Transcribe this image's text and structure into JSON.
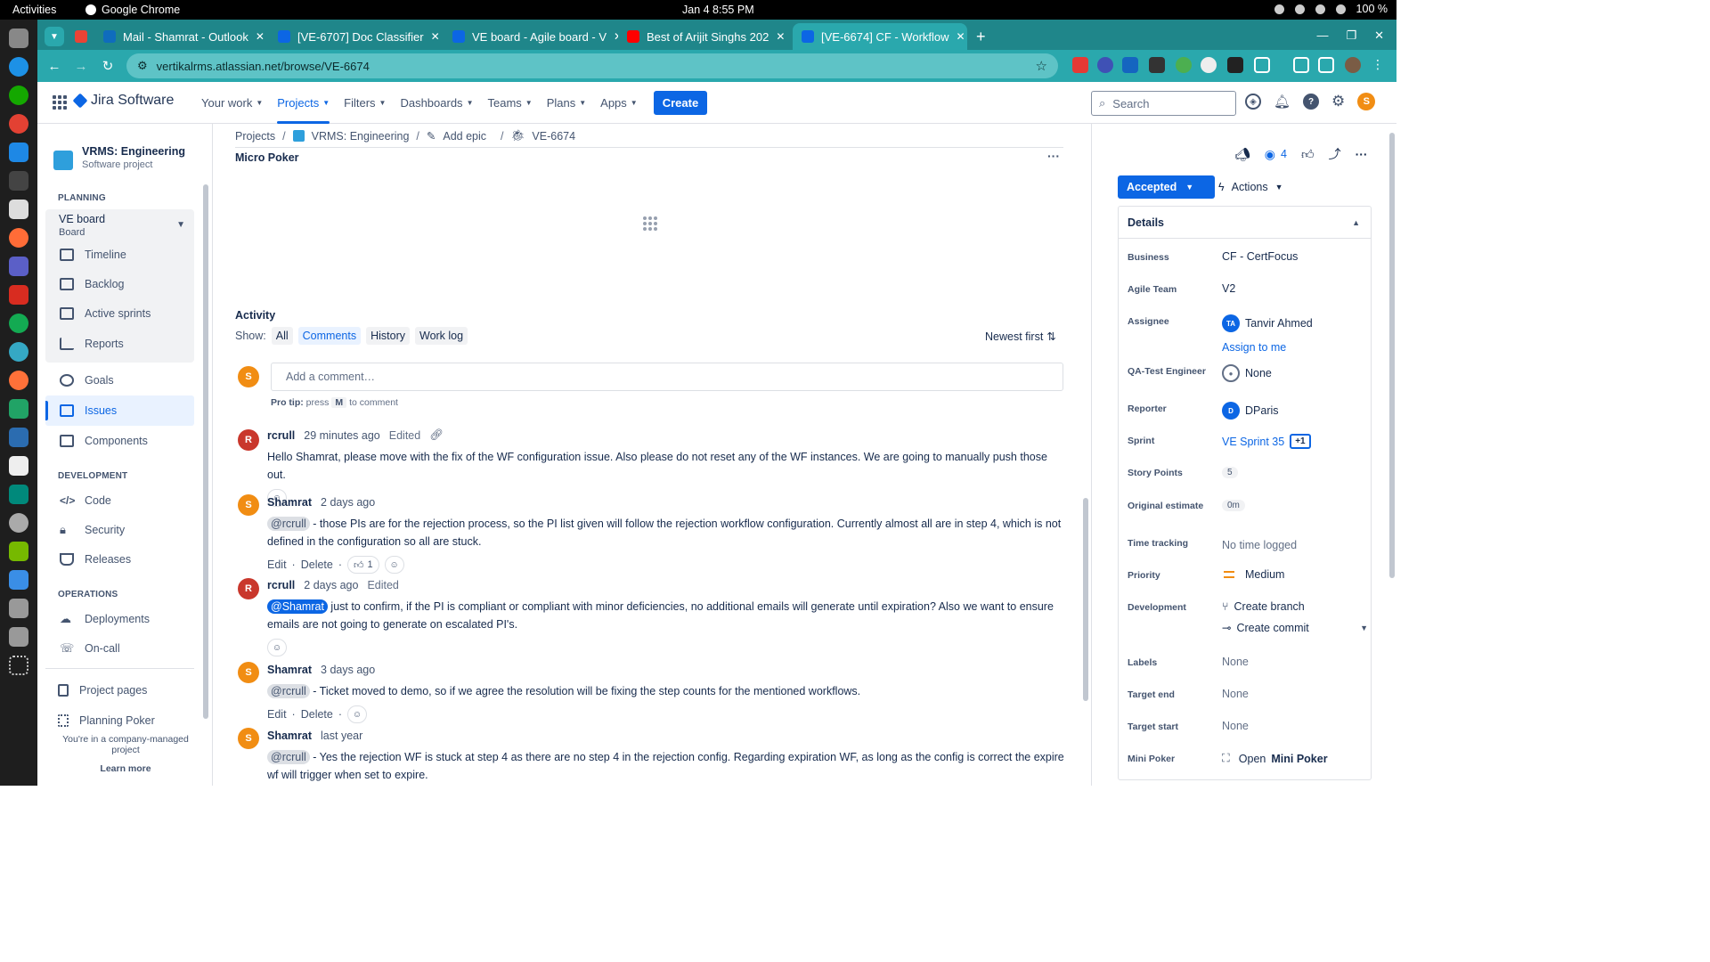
{
  "os": {
    "activities": "Activities",
    "app_name": "Google Chrome",
    "clock": "Jan 4  8:55 PM",
    "battery": "100 %"
  },
  "browser": {
    "tabs": [
      {
        "title": "Mail - Shamrat - Outlook",
        "icon": "outlook-icon",
        "color": "#0f6cbd"
      },
      {
        "title": "[VE-6707] Doc Classifier",
        "icon": "jira-icon",
        "color": "#0c66e4"
      },
      {
        "title": "VE board - Agile board - V",
        "icon": "jira-icon",
        "color": "#0c66e4"
      },
      {
        "title": "Best of Arijit Singhs 202",
        "icon": "youtube-icon",
        "color": "#ff0000"
      },
      {
        "title": "[VE-6674] CF - Workflow",
        "icon": "jira-icon",
        "color": "#0c66e4",
        "active": true
      }
    ],
    "url": "vertikalrms.atlassian.net/browse/VE-6674"
  },
  "jira": {
    "product": "Jira Software",
    "nav": {
      "your_work": "Your work",
      "projects": "Projects",
      "filters": "Filters",
      "dashboards": "Dashboards",
      "teams": "Teams",
      "plans": "Plans",
      "apps": "Apps",
      "create": "Create"
    },
    "search_placeholder": "Search",
    "user_initial": "S"
  },
  "sidebar": {
    "project_name": "VRMS: Engineering",
    "project_type": "Software project",
    "planning_title": "PLANNING",
    "board_name": "VE board",
    "board_type": "Board",
    "planning_items": [
      "Timeline",
      "Backlog",
      "Active sprints",
      "Reports"
    ],
    "goals": "Goals",
    "issues": "Issues",
    "components": "Components",
    "development_title": "DEVELOPMENT",
    "development_items": [
      "Code",
      "Security",
      "Releases"
    ],
    "operations_title": "OPERATIONS",
    "operations_items": [
      "Deployments",
      "On-call"
    ],
    "project_pages": "Project pages",
    "planning_poker": "Planning Poker",
    "footer": "You're in a company-managed project",
    "learn_more": "Learn more"
  },
  "main": {
    "breadcrumb": [
      "Projects",
      "VRMS: Engineering",
      "Add epic",
      "VE-6674"
    ],
    "micro_poker": "Micro Poker",
    "activity_title": "Activity",
    "show_label": "Show:",
    "filters": [
      "All",
      "Comments",
      "History",
      "Work log"
    ],
    "selected_filter": "Comments",
    "sort": "Newest first",
    "add_comment_placeholder": "Add a comment…",
    "protip_prefix": "Pro tip:",
    "protip_press": "press",
    "protip_key": "M",
    "protip_suffix": "to comment",
    "edit": "Edit",
    "delete": "Delete",
    "comments": [
      {
        "author": "rcrull",
        "initial": "R",
        "time": "29 minutes ago",
        "edited": "Edited",
        "mention": "",
        "text": "Hello Shamrat, please move with the fix of the WF configuration issue. Also please do not reset any of the WF instances. We are going to manually push those out."
      },
      {
        "author": "Shamrat",
        "initial": "S",
        "time": "2 days ago",
        "edited": "",
        "mention": "@rcrull",
        "text": " - those PIs are for the rejection process, so the PI list given will follow the rejection workflow configuration. Currently almost all are in step 4, which is not defined in the configuration so all are stuck.",
        "reaction_count": "1"
      },
      {
        "author": "rcrull",
        "initial": "R",
        "time": "2 days ago",
        "edited": "Edited",
        "mention": "@Shamrat",
        "text": " just to confirm, if the PI is compliant or compliant with minor deficiencies, no additional emails will generate until expiration? Also we want to ensure emails are not going to generate on escalated PI's."
      },
      {
        "author": "Shamrat",
        "initial": "S",
        "time": "3 days ago",
        "edited": "",
        "mention": "@rcrull",
        "text": " - Ticket moved to demo, so if we agree the resolution will be fixing the step counts for the mentioned workflows."
      },
      {
        "author": "Shamrat",
        "initial": "S",
        "time": "last year",
        "edited": "",
        "mention": "@rcrull",
        "text": " - Yes the rejection WF is stuck at step 4 as there are no step 4 in the rejection config. Regarding expiration WF, as long as the config is correct the expire wf will trigger when set to expire."
      }
    ]
  },
  "details": {
    "watchers": "4",
    "status": "Accepted",
    "actions": "Actions",
    "title": "Details",
    "business_label": "Business",
    "business": "CF - CertFocus",
    "agile_team_label": "Agile Team",
    "agile_team": "V2",
    "assignee_label": "Assignee",
    "assignee_initials": "TA",
    "assignee": "Tanvir Ahmed",
    "assign_to_me": "Assign to me",
    "qa_label": "QA-Test Engineer",
    "qa": "None",
    "reporter_label": "Reporter",
    "reporter_initial": "D",
    "reporter": "DParis",
    "sprint_label": "Sprint",
    "sprint": "VE Sprint 35",
    "sprint_more": "+1",
    "story_points_label": "Story Points",
    "story_points": "5",
    "original_estimate_label": "Original estimate",
    "original_estimate": "0m",
    "time_tracking_label": "Time tracking",
    "time_tracking": "No time logged",
    "priority_label": "Priority",
    "priority": "Medium",
    "development_label": "Development",
    "create_branch": "Create branch",
    "create_commit": "Create commit",
    "labels_label": "Labels",
    "labels": "None",
    "target_end_label": "Target end",
    "target_end": "None",
    "target_start_label": "Target start",
    "target_start": "None",
    "mini_poker_label": "Mini Poker",
    "mini_poker_open": "Open",
    "mini_poker_name": "Mini Poker"
  }
}
